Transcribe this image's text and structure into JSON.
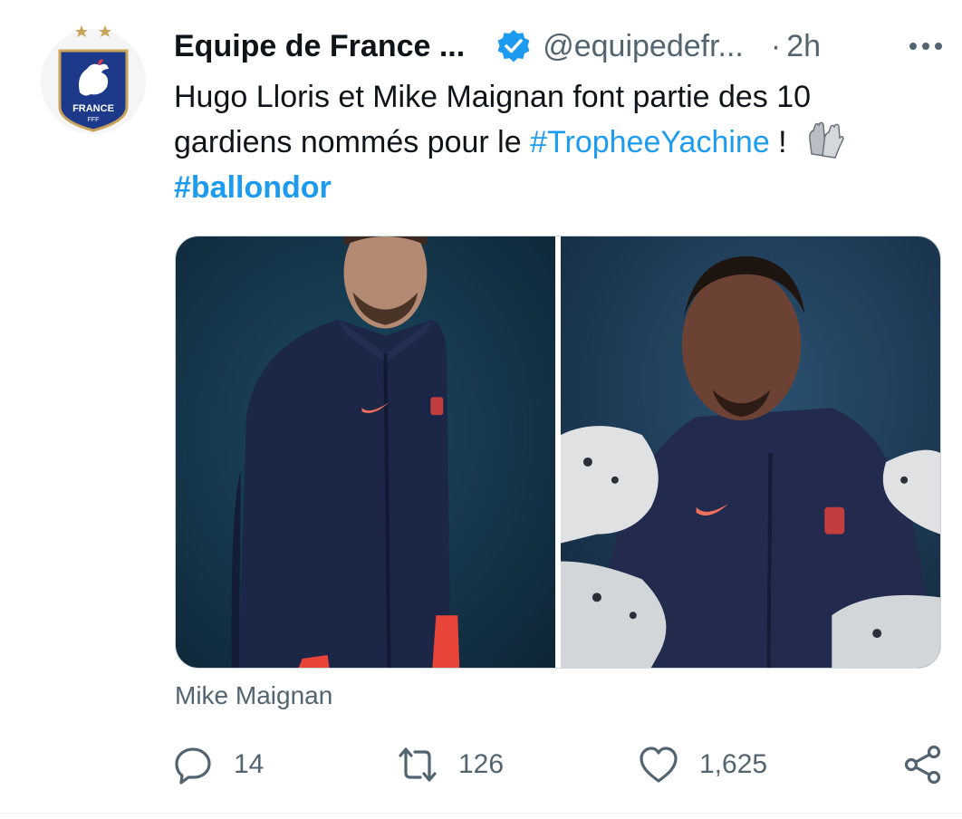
{
  "account": {
    "display_name": "Equipe de France ...",
    "handle": "@equipedefr...",
    "separator": "·",
    "time": "2h",
    "avatar_icon": "fff-crest-icon",
    "avatar_text": "FRANCE",
    "avatar_sub": "FFF"
  },
  "tweet": {
    "text_part1": "Hugo Lloris et Mike Maignan font partie des 10 gardiens nommés pour le ",
    "hashtag1": "#TropheeYachine",
    "text_part2": " ! ",
    "emoji_icon": "gloves-emoji-icon",
    "hashtag2": "#ballondor"
  },
  "media": {
    "caption": "Mike Maignan"
  },
  "actions": {
    "reply_count": "14",
    "retweet_count": "126",
    "like_count": "1,625"
  },
  "colors": {
    "accent": "#1d9bf0",
    "secondary_text": "#536471",
    "primary_text": "#0f1419",
    "crest_blue": "#1d3a8a"
  }
}
